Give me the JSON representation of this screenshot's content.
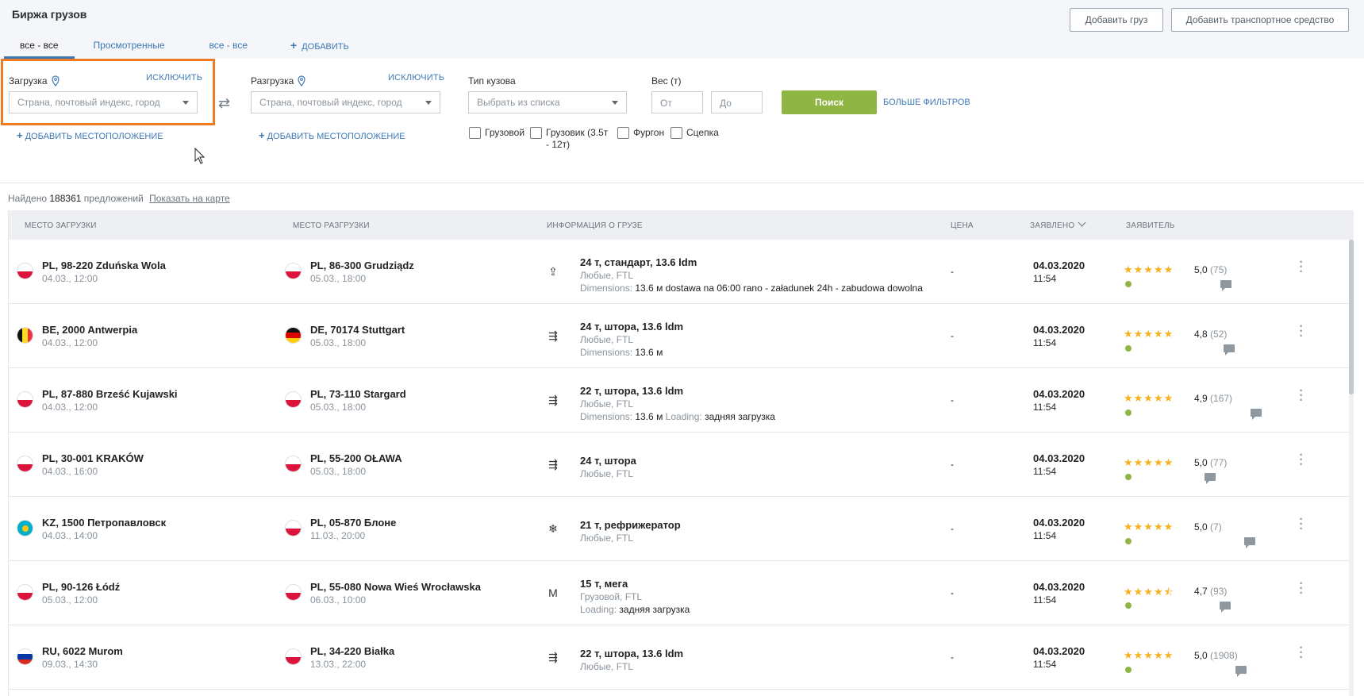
{
  "header": {
    "title": "Биржа грузов",
    "add_cargo_label": "Добавить груз",
    "add_vehicle_label": "Добавить транспортное средство",
    "tabs": [
      {
        "label": "все - все",
        "active": true
      },
      {
        "label": "Просмотренные",
        "active": false
      },
      {
        "label": "все - все",
        "active": false
      }
    ],
    "add_tab_label": "ДОБАВИТЬ"
  },
  "filters": {
    "loading": {
      "label": "Загрузка",
      "exclude_label": "ИСКЛЮЧИТЬ",
      "placeholder": "Страна, почтовый индекс, город",
      "add_location_label": "ДОБАВИТЬ МЕСТОПОЛОЖЕНИЕ"
    },
    "unloading": {
      "label": "Разгрузка",
      "exclude_label": "ИСКЛЮЧИТЬ",
      "placeholder": "Страна, почтовый индекс, город",
      "add_location_label": "ДОБАВИТЬ МЕСТОПОЛОЖЕНИЕ"
    },
    "body_type": {
      "label": "Тип кузова",
      "placeholder": "Выбрать из списка"
    },
    "weight": {
      "label": "Вес (т)",
      "from_placeholder": "От",
      "to_placeholder": "До"
    },
    "vehicle_types": [
      {
        "label": "Грузовой",
        "checked": false
      },
      {
        "label": "Грузовик (3.5т",
        "label2": "- 12т)",
        "checked": false
      },
      {
        "label": "Фургон",
        "checked": false
      },
      {
        "label": "Сцепка",
        "checked": false
      }
    ],
    "search_label": "Поиск",
    "more_filters_label": "БОЛЬШЕ ФИЛЬТРОВ"
  },
  "results": {
    "found_label": "Найдено",
    "count": "188361",
    "offers_label": "предложений",
    "show_on_map_label": "Показать на карте"
  },
  "table": {
    "columns": {
      "loading_place": "МЕСТО ЗАГРУЗКИ",
      "unloading_place": "МЕСТО РАЗГРУЗКИ",
      "cargo_info": "ИНФОРМАЦИЯ О ГРУЗЕ",
      "price": "ЦЕНА",
      "declared": "ЗАЯВЛЕНО",
      "applicant": "ЗАЯВИТЕЛЬ"
    },
    "rows": [
      {
        "from": "PL, 98-220 Zduńska Wola",
        "from_date": "04.03., 12:00",
        "from_flag": "pl",
        "to": "PL, 86-300 Grudziądz",
        "to_date": "05.03., 18:00",
        "to_flag": "pl",
        "icon": "upload-icon",
        "cargo": "24 т, стандарт, 13.6 ldm",
        "sub": "Любые, FTL",
        "extra_key": "Dimensions:",
        "extra_val": "13.6 м dostawa na 06:00 rano - załadunek 24h - zabudowa dowolna",
        "extra_key2": "",
        "extra_val2": "",
        "price": "-",
        "date": "04.03.2020",
        "time": "11:54",
        "stars": "★★★★★",
        "rating": "5,0",
        "reviews": "(75)"
      },
      {
        "from": "BE, 2000 Antwerpia",
        "from_date": "04.03., 12:00",
        "from_flag": "be",
        "to": "DE, 70174 Stuttgart",
        "to_date": "05.03., 18:00",
        "to_flag": "de",
        "icon": "side-load-icon",
        "cargo": "24 т, штора, 13.6 ldm",
        "sub": "Любые, FTL",
        "extra_key": "Dimensions:",
        "extra_val": "13.6 м",
        "extra_key2": "",
        "extra_val2": "",
        "price": "-",
        "date": "04.03.2020",
        "time": "11:54",
        "stars": "★★★★★",
        "rating": "4,8",
        "reviews": "(52)"
      },
      {
        "from": "PL, 87-880 Brześć Kujawski",
        "from_date": "04.03., 12:00",
        "from_flag": "pl",
        "to": "PL, 73-110 Stargard",
        "to_date": "05.03., 18:00",
        "to_flag": "pl",
        "icon": "side-load-icon",
        "cargo": "22 т, штора, 13.6 ldm",
        "sub": "Любые, FTL",
        "extra_key": "Dimensions:",
        "extra_val": "13.6 м",
        "extra_key2": "Loading:",
        "extra_val2": "задняя загрузка",
        "price": "-",
        "date": "04.03.2020",
        "time": "11:54",
        "stars": "★★★★★",
        "rating": "4,9",
        "reviews": "(167)"
      },
      {
        "from": "PL, 30-001 KRAKÓW",
        "from_date": "04.03., 16:00",
        "from_flag": "pl",
        "to": "PL, 55-200 OŁAWA",
        "to_date": "05.03., 18:00",
        "to_flag": "pl",
        "icon": "side-load-icon",
        "cargo": "24 т, штора",
        "sub": "Любые, FTL",
        "extra_key": "",
        "extra_val": "",
        "extra_key2": "",
        "extra_val2": "",
        "price": "-",
        "date": "04.03.2020",
        "time": "11:54",
        "stars": "★★★★★",
        "rating": "5,0",
        "reviews": "(77)"
      },
      {
        "from": "KZ, 1500 Петропавловск",
        "from_date": "04.03., 14:00",
        "from_flag": "kz",
        "to": "PL, 05-870 Блоне",
        "to_date": "11.03., 20:00",
        "to_flag": "pl",
        "icon": "snowflake-icon",
        "cargo": "21 т, рефрижератор",
        "sub": "Любые, FTL",
        "extra_key": "",
        "extra_val": "",
        "extra_key2": "",
        "extra_val2": "",
        "price": "-",
        "date": "04.03.2020",
        "time": "11:54",
        "stars": "★★★★★",
        "rating": "5,0",
        "reviews": "(7)"
      },
      {
        "from": "PL, 90-126 Łódź",
        "from_date": "05.03., 12:00",
        "from_flag": "pl",
        "to": "PL, 55-080 Nowa Wieś Wrocławska",
        "to_date": "06.03., 10:00",
        "to_flag": "pl",
        "icon": "mega-icon",
        "cargo": "15 т, мега",
        "sub": "Грузовой, FTL",
        "extra_key": "Loading:",
        "extra_val": "задняя загрузка",
        "extra_key2": "",
        "extra_val2": "",
        "price": "-",
        "date": "04.03.2020",
        "time": "11:54",
        "stars": "★★★★⯪",
        "rating": "4,7",
        "reviews": "(93)"
      },
      {
        "from": "RU, 6022 Murom",
        "from_date": "09.03., 14:30",
        "from_flag": "ru",
        "to": "PL, 34-220 Białka",
        "to_date": "13.03., 22:00",
        "to_flag": "pl",
        "icon": "side-load-icon",
        "cargo": "22 т, штора, 13.6 ldm",
        "sub": "Любые, FTL",
        "extra_key": "",
        "extra_val": "",
        "extra_key2": "",
        "extra_val2": "",
        "price": "-",
        "date": "04.03.2020",
        "time": "11:54",
        "stars": "★★★★★",
        "rating": "5,0",
        "reviews": "(1908)"
      }
    ]
  },
  "colors": {
    "accent": "#3d78b3",
    "search_button": "#8fb544",
    "highlight": "#f07b22",
    "star": "#f5b21e"
  }
}
